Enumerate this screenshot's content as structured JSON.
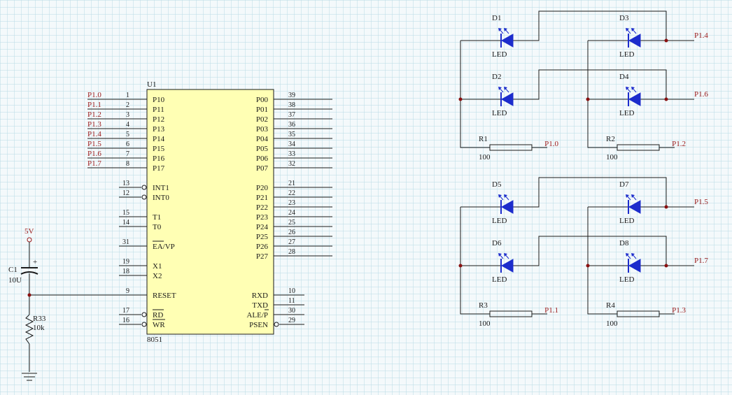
{
  "chip": {
    "ref": "U1",
    "part": "8051",
    "left_pins": [
      {
        "name": "P10",
        "num": "1",
        "net": "P1.0"
      },
      {
        "name": "P11",
        "num": "2",
        "net": "P1.1"
      },
      {
        "name": "P12",
        "num": "3",
        "net": "P1.2"
      },
      {
        "name": "P13",
        "num": "4",
        "net": "P1.3"
      },
      {
        "name": "P14",
        "num": "5",
        "net": "P1.4"
      },
      {
        "name": "P15",
        "num": "6",
        "net": "P1.5"
      },
      {
        "name": "P16",
        "num": "7",
        "net": "P1.6"
      },
      {
        "name": "P17",
        "num": "8",
        "net": "P1.7"
      },
      {
        "name": "INT1",
        "num": "13",
        "net": ""
      },
      {
        "name": "INT0",
        "num": "12",
        "net": ""
      },
      {
        "name": "T1",
        "num": "15",
        "net": ""
      },
      {
        "name": "T0",
        "num": "14",
        "net": ""
      },
      {
        "name": "EA/VP",
        "num": "31",
        "net": ""
      },
      {
        "name": "X1",
        "num": "19",
        "net": ""
      },
      {
        "name": "X2",
        "num": "18",
        "net": ""
      },
      {
        "name": "RESET",
        "num": "9",
        "net": ""
      },
      {
        "name": "RD",
        "num": "17",
        "net": ""
      },
      {
        "name": "WR",
        "num": "16",
        "net": ""
      }
    ],
    "right_pins": [
      {
        "name": "P00",
        "num": "39"
      },
      {
        "name": "P01",
        "num": "38"
      },
      {
        "name": "P02",
        "num": "37"
      },
      {
        "name": "P03",
        "num": "36"
      },
      {
        "name": "P04",
        "num": "35"
      },
      {
        "name": "P05",
        "num": "34"
      },
      {
        "name": "P06",
        "num": "33"
      },
      {
        "name": "P07",
        "num": "32"
      },
      {
        "name": "P20",
        "num": "21"
      },
      {
        "name": "P21",
        "num": "22"
      },
      {
        "name": "P22",
        "num": "23"
      },
      {
        "name": "P23",
        "num": "24"
      },
      {
        "name": "P24",
        "num": "25"
      },
      {
        "name": "P25",
        "num": "26"
      },
      {
        "name": "P26",
        "num": "27"
      },
      {
        "name": "P27",
        "num": "28"
      },
      {
        "name": "RXD",
        "num": "10"
      },
      {
        "name": "TXD",
        "num": "11"
      },
      {
        "name": "ALE/P",
        "num": "30"
      },
      {
        "name": "PSEN",
        "num": "29"
      }
    ]
  },
  "power": {
    "label": "5V"
  },
  "capacitor": {
    "ref": "C1",
    "value": "10U",
    "polarity": "+"
  },
  "reset_resistor": {
    "ref": "R33",
    "value": "10k"
  },
  "matrices": [
    {
      "leds": [
        {
          "ref": "D1",
          "type": "LED"
        },
        {
          "ref": "D3",
          "type": "LED"
        },
        {
          "ref": "D2",
          "type": "LED"
        },
        {
          "ref": "D4",
          "type": "LED"
        }
      ],
      "row_nets": [
        "P1.4",
        "P1.6"
      ],
      "resistors": [
        {
          "ref": "R1",
          "value": "100",
          "net": "P1.0"
        },
        {
          "ref": "R2",
          "value": "100",
          "net": "P1.2"
        }
      ]
    },
    {
      "leds": [
        {
          "ref": "D5",
          "type": "LED"
        },
        {
          "ref": "D7",
          "type": "LED"
        },
        {
          "ref": "D6",
          "type": "LED"
        },
        {
          "ref": "D8",
          "type": "LED"
        }
      ],
      "row_nets": [
        "P1.5",
        "P1.7"
      ],
      "resistors": [
        {
          "ref": "R3",
          "value": "100",
          "net": "P1.1"
        },
        {
          "ref": "R4",
          "value": "100",
          "net": "P1.3"
        }
      ]
    }
  ],
  "colors": {
    "background": "#f4f9fb",
    "grid": "#b9dbe6",
    "wire": "#1a1a1a",
    "chip_fill": "#ffffb4",
    "led": "#1c2ccc",
    "net_label": "#9a1a1a",
    "junction": "#8a1010"
  }
}
